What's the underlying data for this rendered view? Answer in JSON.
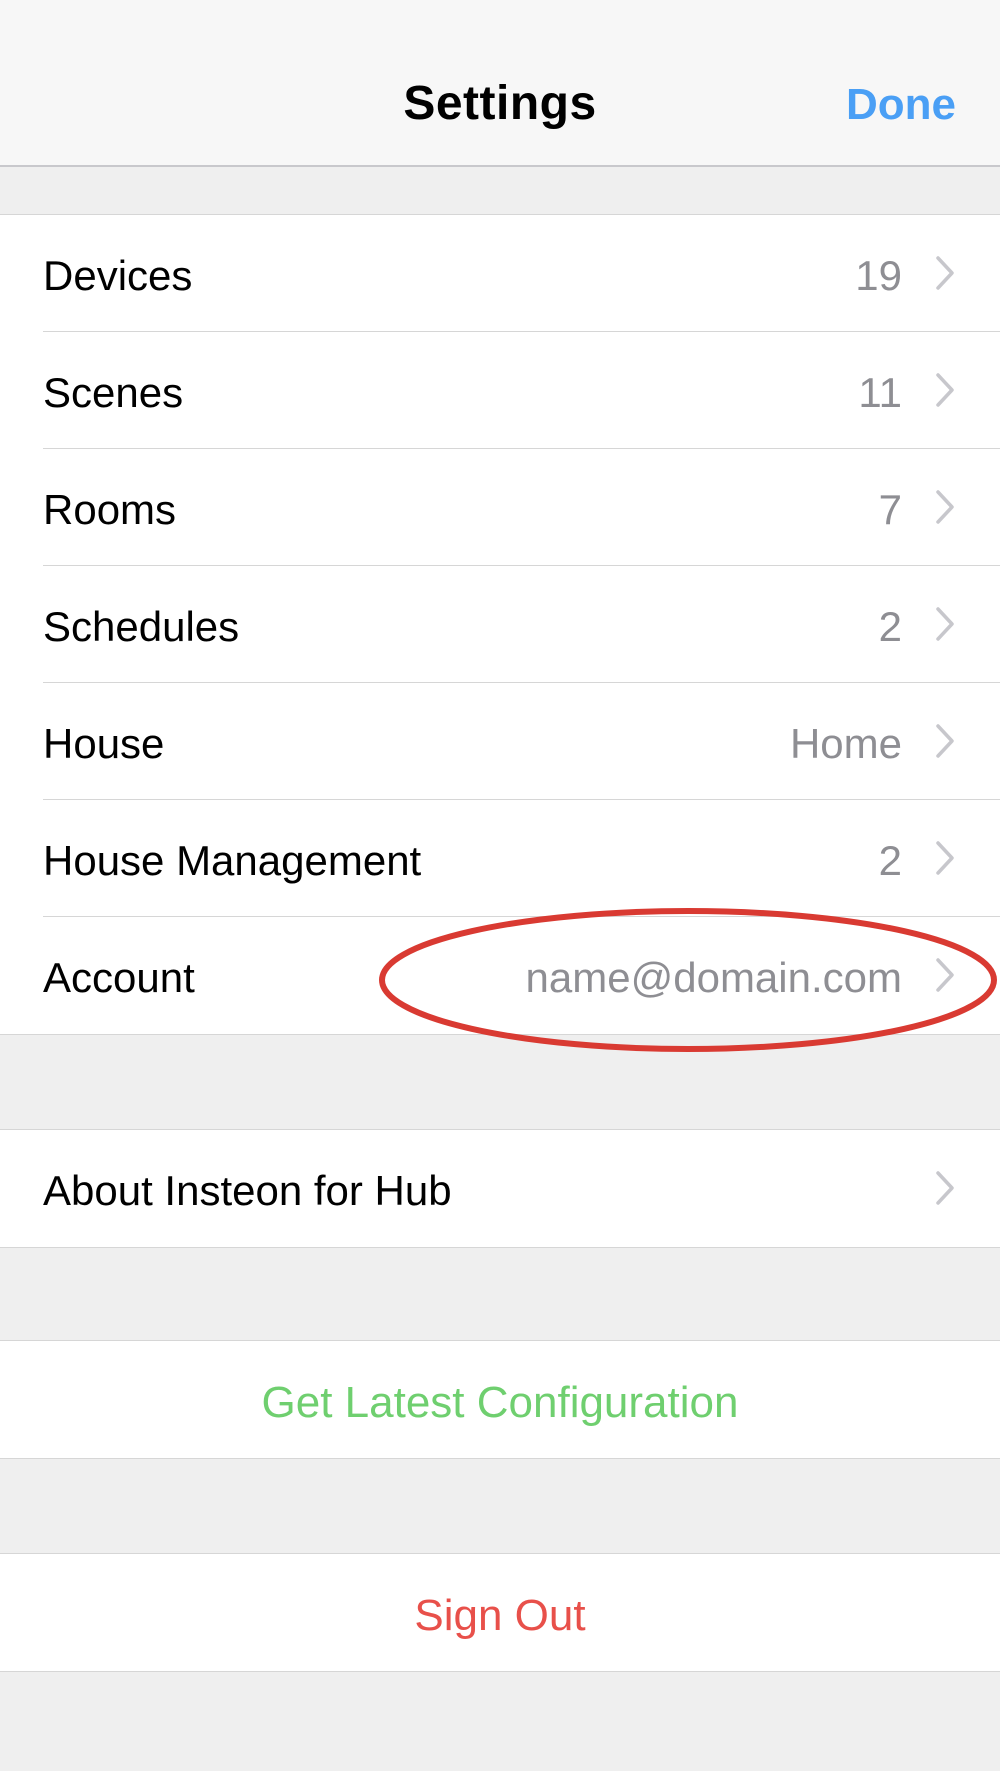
{
  "navbar": {
    "title": "Settings",
    "done_label": "Done"
  },
  "main_list": [
    {
      "label": "Devices",
      "value": "19"
    },
    {
      "label": "Scenes",
      "value": "11"
    },
    {
      "label": "Rooms",
      "value": "7"
    },
    {
      "label": "Schedules",
      "value": "2"
    },
    {
      "label": "House",
      "value": "Home"
    },
    {
      "label": "House Management",
      "value": "2"
    },
    {
      "label": "Account",
      "value": "name@domain.com"
    }
  ],
  "about": {
    "label": "About Insteon for Hub"
  },
  "config": {
    "label": "Get Latest Configuration"
  },
  "signout": {
    "label": "Sign Out"
  },
  "colors": {
    "accent_blue": "#4a9ff5",
    "config_green": "#6fcf6f",
    "signout_red": "#e8504a",
    "annotation_red": "#d93a32"
  },
  "icons": {
    "chevron": "chevron-right-icon"
  }
}
